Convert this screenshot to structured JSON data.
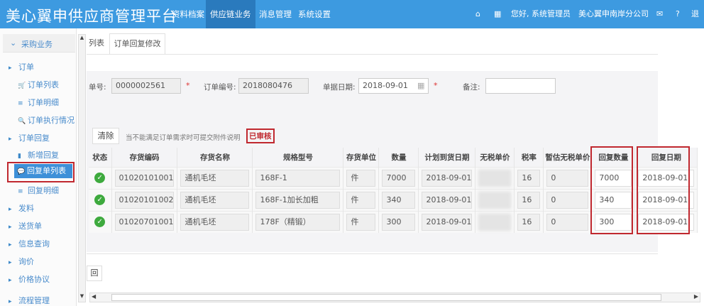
{
  "header": {
    "title": "美心翼申供应商管理平台",
    "nav": [
      "资料档案",
      "供应链业务",
      "消息管理",
      "系统设置"
    ],
    "active_nav": 1,
    "greeting": "您好, 系统管理员",
    "company": "美心翼申南岸分公司",
    "logout": "退出"
  },
  "sidebar": {
    "section": "采购业务",
    "items": [
      {
        "label": "订单",
        "level": 1,
        "icon": "caret-right-icon"
      },
      {
        "label": "订单列表",
        "level": 2,
        "icon": "cart-icon"
      },
      {
        "label": "订单明细",
        "level": 2,
        "icon": "list-icon"
      },
      {
        "label": "订单执行情况",
        "level": 2,
        "icon": "search-icon"
      },
      {
        "label": "订单回复",
        "level": 1,
        "icon": "caret-right-icon"
      },
      {
        "label": "新增回复",
        "level": 2,
        "icon": "file-icon"
      },
      {
        "label": "回复单列表",
        "level": 2,
        "icon": "comments-icon",
        "active": true
      },
      {
        "label": "回复明细",
        "level": 2,
        "icon": "list-icon"
      },
      {
        "label": "发料",
        "level": 1,
        "icon": "caret-right-icon"
      },
      {
        "label": "送货单",
        "level": 1,
        "icon": "caret-right-icon"
      },
      {
        "label": "信息查询",
        "level": 1,
        "icon": "caret-right-icon"
      },
      {
        "label": "询价",
        "level": 1,
        "icon": "caret-right-icon"
      },
      {
        "label": "价格协议",
        "level": 1,
        "icon": "caret-right-icon"
      },
      {
        "label": "流程管理",
        "level": 1,
        "icon": "caret-right-icon"
      }
    ]
  },
  "tabs": [
    "列表",
    "订单回复修改"
  ],
  "form": {
    "no_label": "单号:",
    "no": "0000002561",
    "order_label": "订单编号:",
    "order": "2018080476",
    "date_label": "单据日期:",
    "date": "2018-09-01",
    "remark_label": "备注:",
    "remark": ""
  },
  "toolbar": {
    "clear": "清除",
    "note": "当不能满足订单需求时可提交附件说明",
    "status": "已审核"
  },
  "table": {
    "headers": [
      "状态",
      "存货编码",
      "存货名称",
      "规格型号",
      "存货单位",
      "数量",
      "计划到货日期",
      "无税单价",
      "税率",
      "暂估无税单价",
      "回复数量",
      "回复日期"
    ],
    "rows": [
      [
        "01020101001",
        "通机毛坯",
        "168F-1",
        "件",
        "7000",
        "2018-09-01",
        "",
        "16",
        "0",
        "7000",
        "2018-09-01"
      ],
      [
        "01020101002",
        "通机毛坯",
        "168F-1加长加粗",
        "件",
        "340",
        "2018-09-01",
        "",
        "16",
        "0",
        "340",
        "2018-09-01"
      ],
      [
        "01020701001",
        "通机毛坯",
        "178F（精锻）",
        "件",
        "300",
        "2018-09-01",
        "",
        "16",
        "0",
        "300",
        "2018-09-01"
      ]
    ]
  },
  "bottom": {
    "back": "回"
  },
  "colors": {
    "header": "#3d9ae0",
    "accent": "#c0282f"
  }
}
